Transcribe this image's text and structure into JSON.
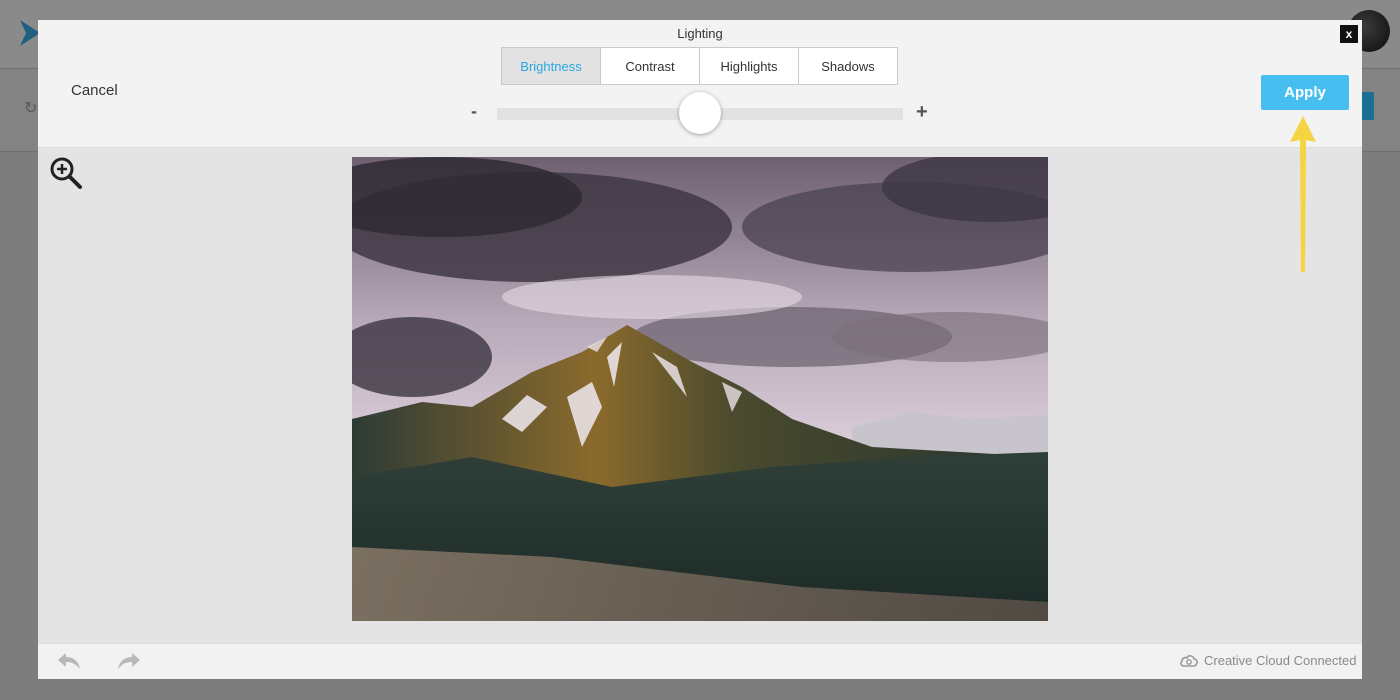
{
  "modal": {
    "title": "Lighting",
    "close_label": "x",
    "cancel_label": "Cancel",
    "apply_label": "Apply",
    "tabs": [
      {
        "label": "Brightness",
        "active": true
      },
      {
        "label": "Contrast",
        "active": false
      },
      {
        "label": "Highlights",
        "active": false
      },
      {
        "label": "Shadows",
        "active": false
      }
    ],
    "slider": {
      "minus_label": "-",
      "plus_label": "+",
      "value": 0.5
    },
    "zoom_icon": "zoom-in-icon",
    "footer": {
      "undo_icon": "undo-icon",
      "redo_icon": "redo-icon",
      "cc_label": "Creative Cloud Connected"
    }
  },
  "colors": {
    "accent": "#46bff0",
    "active_tab_text": "#29a8e0",
    "annotation_arrow": "#f5d442"
  }
}
